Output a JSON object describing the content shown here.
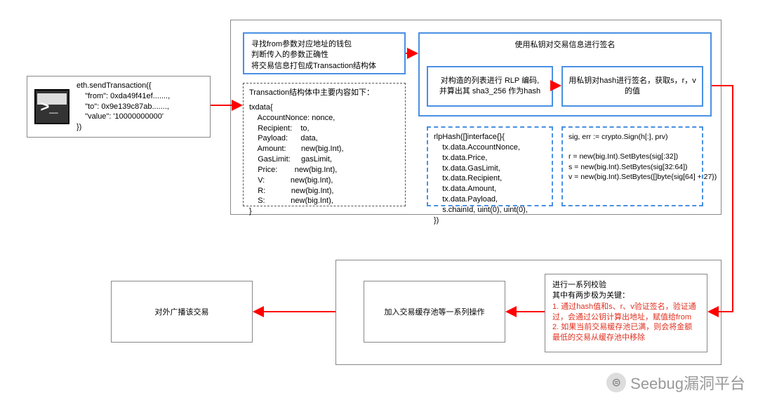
{
  "boxes": {
    "terminal": {
      "glyph": ">_",
      "code": "eth.sendTransaction({\n    \"from\": 0xda49f41ef.......,\n    \"to\": 0x9e139c87ab.......,\n    \"value\": '10000000000'\n})"
    },
    "top_container": {},
    "find_wallet": {
      "l1": "寻找from参数对应地址的钱包",
      "l2": "判断传入的参数正确性",
      "l3": "将交易信息打包成Transaction结构体"
    },
    "tx_struct": {
      "title": "Transaction结构体中主要内容如下：",
      "body": "txdata{\n    AccountNonce: nonce,\n    Recipient:    to,\n    Payload:      data,\n    Amount:       new(big.Int),\n    GasLimit:     gasLimit,\n    Price:        new(big.Int),\n    V:            new(big.Int),\n    R:            new(big.Int),\n    S:            new(big.Int),\n}"
    },
    "sign_container": {
      "title": "使用私钥对交易信息进行签名"
    },
    "rlp_encode": {
      "text": "对构造的列表进行 RLP 编码,\n并算出其 sha3_256 作为hash"
    },
    "sign_hash": {
      "text": "用私钥对hash进行签名，获取s，r，v的值"
    },
    "rlp_hash": {
      "body": "rlpHash([]interface{}{\n    tx.data.AccountNonce,\n    tx.data.Price,\n    tx.data.GasLimit,\n    tx.data.Recipient,\n    tx.data.Amount,\n    tx.data.Payload,\n    s.chainId, uint(0), uint(0),\n})"
    },
    "crypto_sign": {
      "body": "sig, err := crypto.Sign(h[:], prv)\n\nr = new(big.Int).SetBytes(sig[:32])\ns = new(big.Int).SetBytes(sig[32:64])\nv = new(big.Int).SetBytes([]byte{sig[64] + 27})"
    },
    "bottom_container": {},
    "verify": {
      "title": "进行一系列校验",
      "sub": "其中有两步极为关键：",
      "r1": "1. 通过hash值和s、r、v验证签名，验证通过，会通过公钥计算出地址，赋值给from",
      "r2": "2. 如果当前交易缓存池已满，则会将金额最低的交易从缓存池中移除"
    },
    "join_pool": {
      "text": "加入交易缓存池等一系列操作"
    },
    "broadcast": {
      "text": "对外广播该交易"
    }
  },
  "watermark": {
    "icon": "⊜",
    "text": "Seebug漏洞平台"
  }
}
